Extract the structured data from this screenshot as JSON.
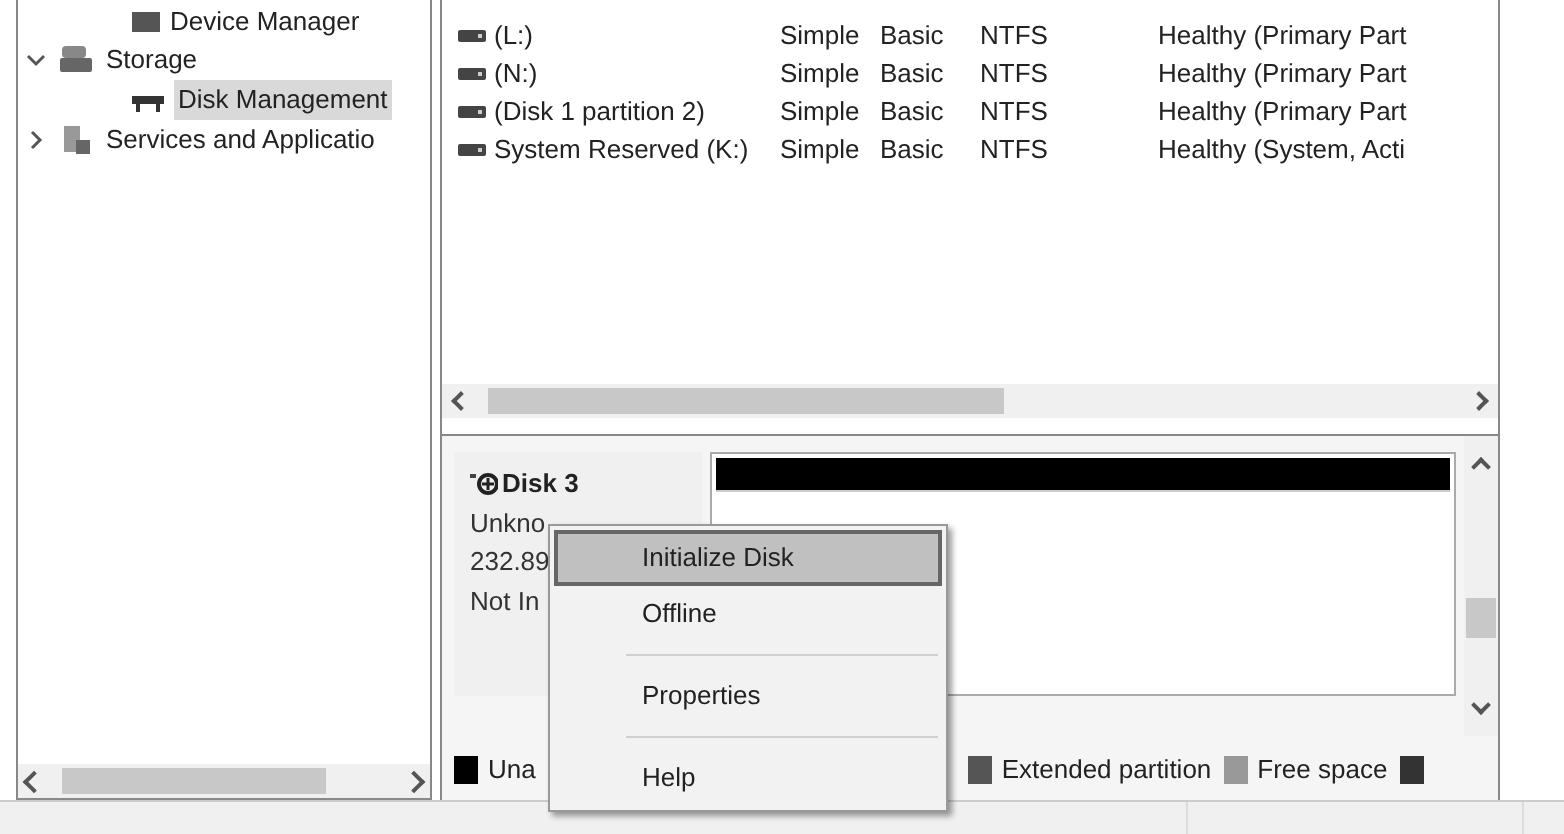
{
  "tree": {
    "items": [
      {
        "label": "Device Manager",
        "kind": "cut"
      },
      {
        "label": "Storage",
        "kind": "node",
        "expanded": true,
        "selected": false,
        "children": [
          {
            "label": "Disk Management",
            "selected": true
          }
        ]
      },
      {
        "label": "Services and Applicatio",
        "kind": "node",
        "expanded": false,
        "selected": false
      }
    ]
  },
  "volumes": {
    "rows": [
      {
        "name": "(L:)",
        "layout": "Simple",
        "type": "Basic",
        "file_system": "NTFS",
        "status": "Healthy (Primary Part"
      },
      {
        "name": "(N:)",
        "layout": "Simple",
        "type": "Basic",
        "file_system": "NTFS",
        "status": "Healthy (Primary Part"
      },
      {
        "name": "(Disk 1 partition 2)",
        "layout": "Simple",
        "type": "Basic",
        "file_system": "NTFS",
        "status": "Healthy (Primary Part"
      },
      {
        "name": "System Reserved (K:)",
        "layout": "Simple",
        "type": "Basic",
        "file_system": "NTFS",
        "status": "Healthy (System, Acti"
      }
    ]
  },
  "disk": {
    "name": "Disk 3",
    "lines": [
      "Unkno",
      "232.89",
      "Not In"
    ]
  },
  "legend": [
    {
      "label": "Una",
      "color": "#000000"
    },
    {
      "label": "Extended partition",
      "color": "#555555"
    },
    {
      "label": "Free space",
      "color": "#999999"
    },
    {
      "color": "#333333"
    }
  ],
  "context_menu": [
    {
      "kind": "item",
      "label": "Initialize Disk",
      "selected": true
    },
    {
      "kind": "item",
      "label": "Offline",
      "selected": false
    },
    {
      "kind": "separator"
    },
    {
      "kind": "item",
      "label": "Properties",
      "selected": false
    },
    {
      "kind": "separator"
    },
    {
      "kind": "item",
      "label": "Help",
      "selected": false
    }
  ]
}
